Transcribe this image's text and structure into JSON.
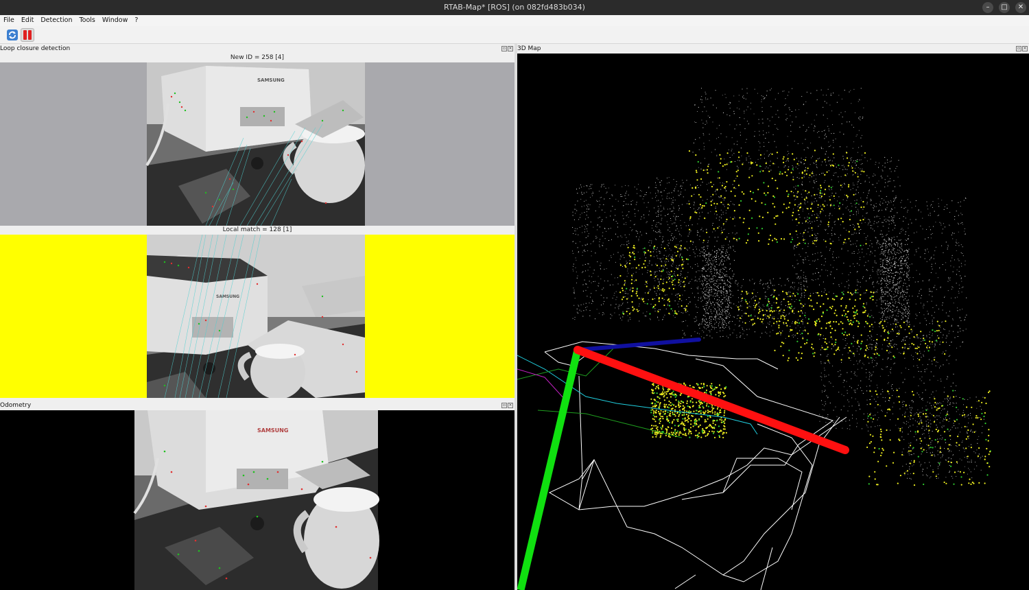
{
  "window": {
    "title": "RTAB-Map* [ROS] (on 082fd483b034)",
    "controls": {
      "minimize": "–",
      "maximize": "□",
      "close": "✕"
    }
  },
  "menubar": {
    "items": [
      {
        "label": "File"
      },
      {
        "label": "Edit"
      },
      {
        "label": "Detection"
      },
      {
        "label": "Tools"
      },
      {
        "label": "Window"
      },
      {
        "label": "?"
      }
    ]
  },
  "toolbar": {
    "buttons": [
      {
        "icon": "refresh-icon"
      },
      {
        "icon": "pause-icon",
        "pressed": true
      }
    ]
  },
  "loop_closure": {
    "panel_title": "Loop closure detection",
    "new_id_label": "New ID = 258 [4]",
    "local_match_label": "Local match = 128 [1]",
    "new_background_color": "#a9a9ad",
    "match_background_color": "#ffff00",
    "printer_brand": "SAMSUNG"
  },
  "odometry": {
    "panel_title": "Odometry",
    "background_color": "#000000",
    "printer_brand": "SAMSUNG"
  },
  "map3d": {
    "panel_title": "3D Map",
    "background_color": "#000000",
    "axis_colors": {
      "x": "#ff1010",
      "y": "#10e010",
      "z": "#1010a0"
    }
  },
  "dock_buttons": {
    "float": "▫",
    "close": "×"
  }
}
